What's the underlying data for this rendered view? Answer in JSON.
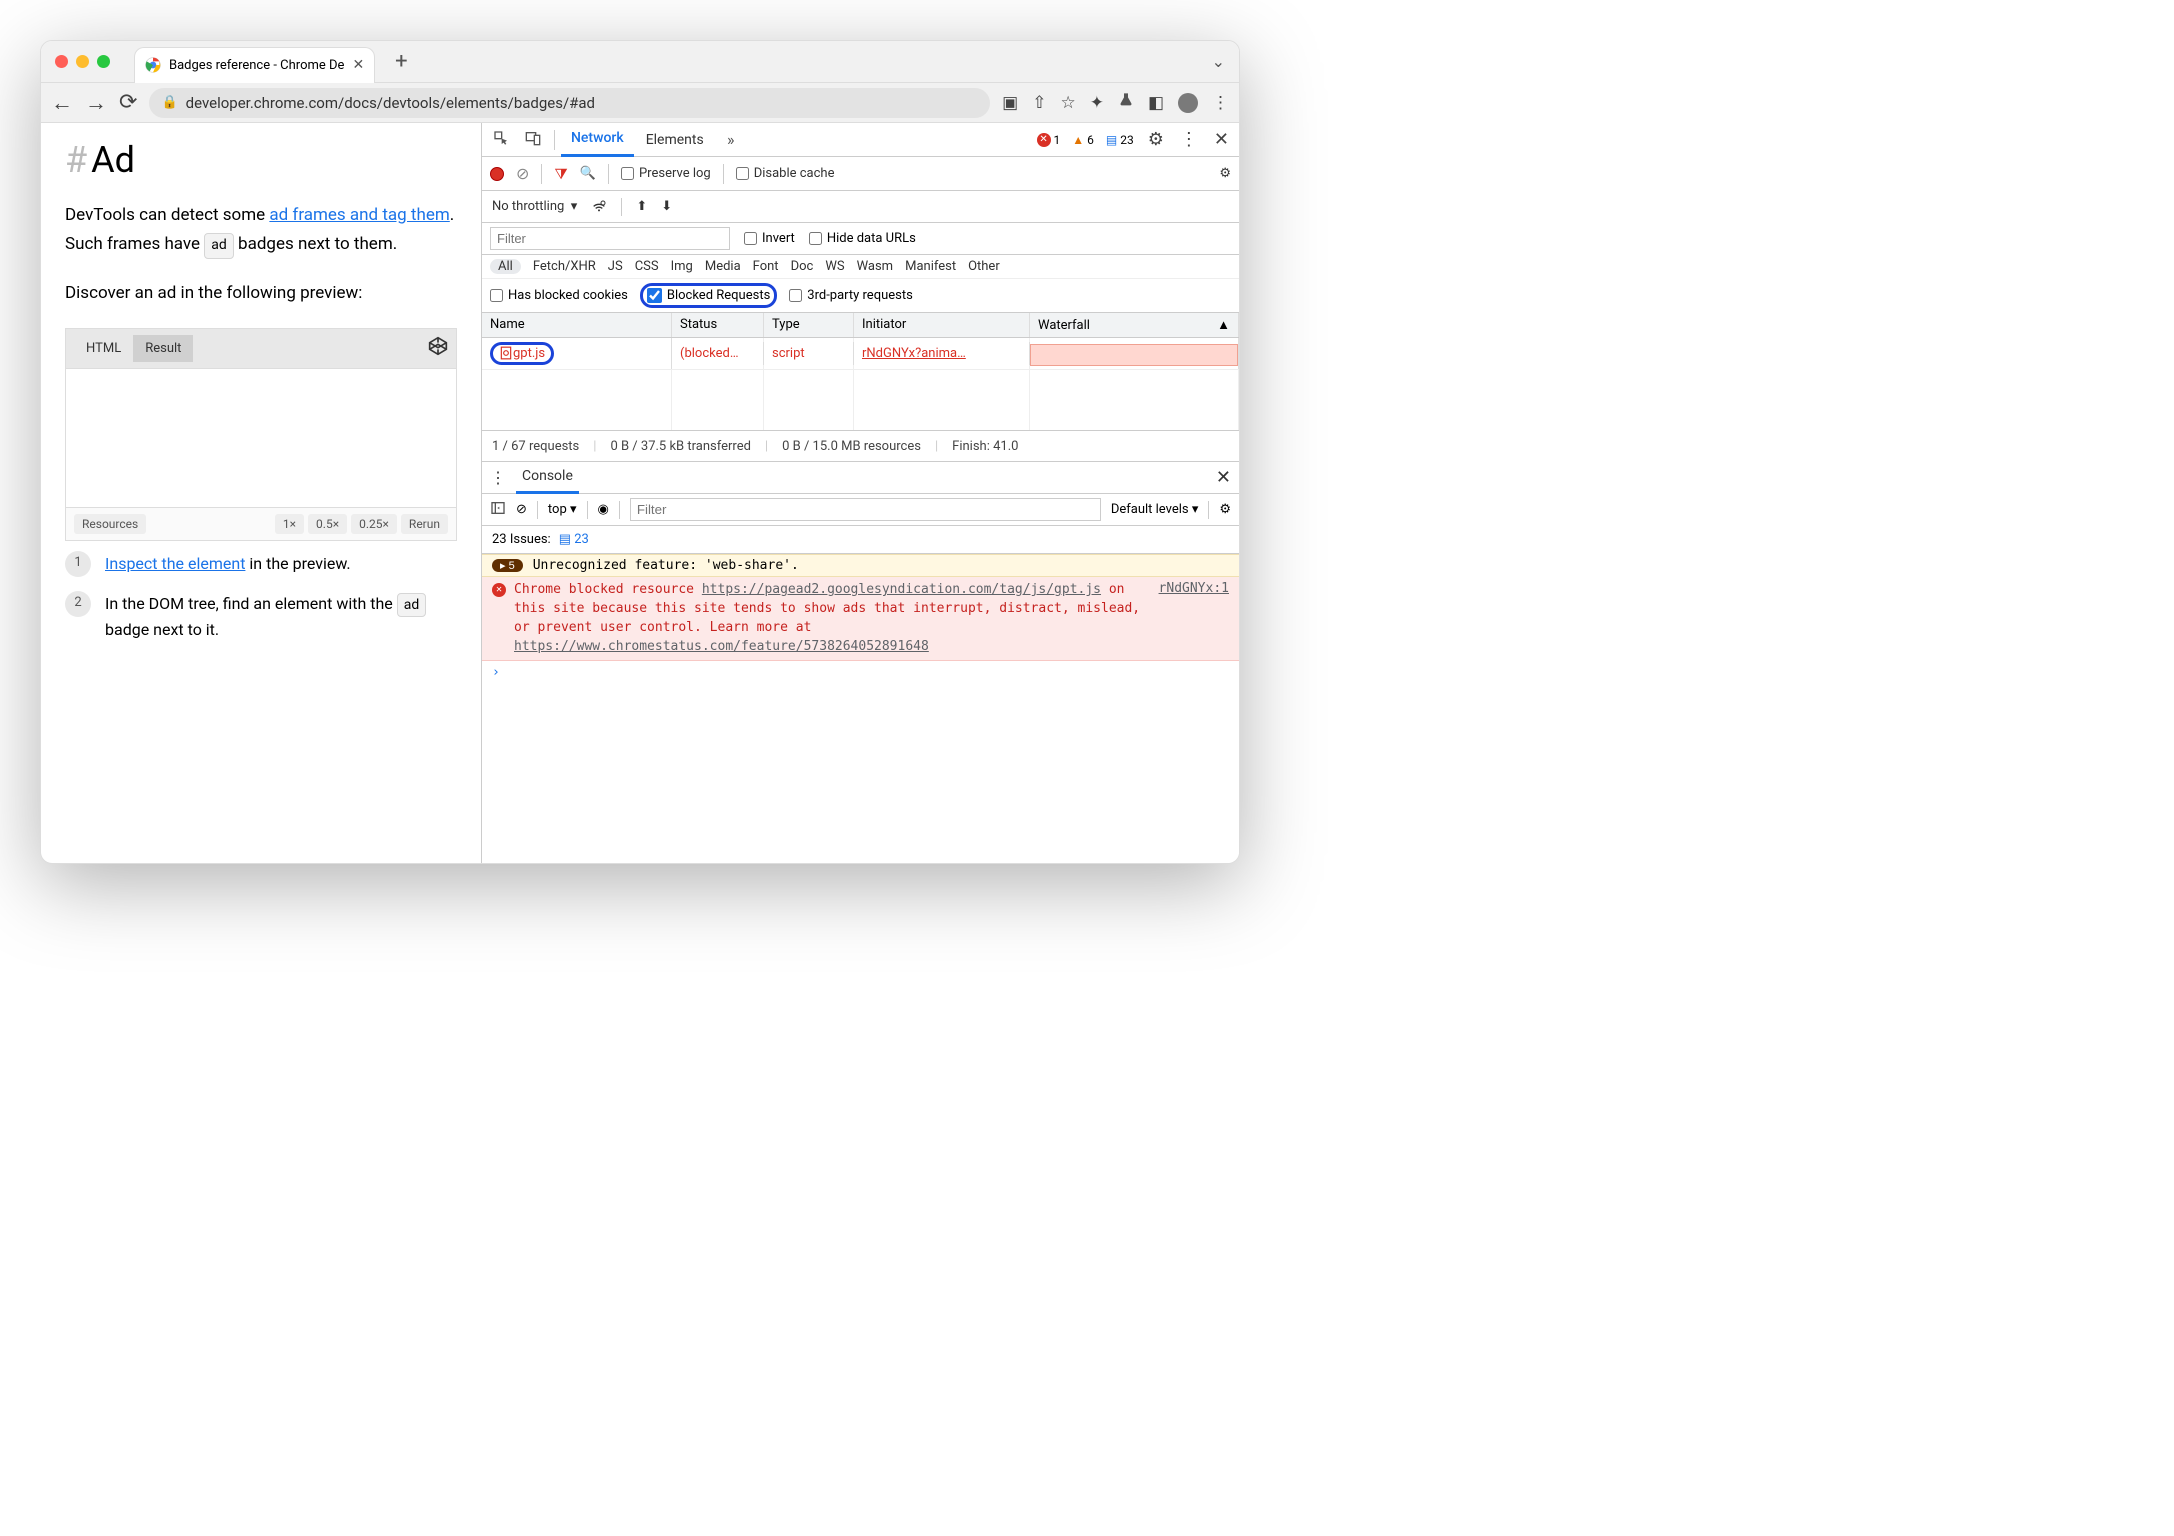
{
  "tab_title": "Badges reference - Chrome De",
  "url": "developer.chrome.com/docs/devtools/elements/badges/#ad",
  "page": {
    "heading": "Ad",
    "p1_a": "DevTools can detect some ",
    "p1_link": "ad frames and tag them",
    "p1_b": ". Such frames have ",
    "p1_badge": "ad",
    "p1_c": " badges next to them.",
    "p2": "Discover an ad in the following preview:",
    "codepen": {
      "tab_html": "HTML",
      "tab_result": "Result",
      "foot_resources": "Resources",
      "foot_1x": "1×",
      "foot_05x": "0.5×",
      "foot_025x": "0.25×",
      "foot_rerun": "Rerun"
    },
    "step1_link": "Inspect the element",
    "step1_rest": " in the preview.",
    "step2_a": "In the DOM tree, find an element with the ",
    "step2_badge": "ad",
    "step2_b": " badge next to it."
  },
  "devtools": {
    "tabs": {
      "network": "Network",
      "elements": "Elements"
    },
    "status": {
      "errors": "1",
      "warnings": "6",
      "messages": "23"
    },
    "toolbar": {
      "preserve_log": "Preserve log",
      "disable_cache": "Disable cache"
    },
    "throttle": "No throttling",
    "filter_placeholder": "Filter",
    "invert": "Invert",
    "hide_urls": "Hide data URLs",
    "chips": [
      "All",
      "Fetch/XHR",
      "JS",
      "CSS",
      "Img",
      "Media",
      "Font",
      "Doc",
      "WS",
      "Wasm",
      "Manifest",
      "Other"
    ],
    "has_blocked_cookies": "Has blocked cookies",
    "blocked_requests": "Blocked Requests",
    "third_party": "3rd-party requests",
    "cols": {
      "name": "Name",
      "status": "Status",
      "type": "Type",
      "initiator": "Initiator",
      "waterfall": "Waterfall"
    },
    "row": {
      "name": "gpt.js",
      "status": "(blocked…",
      "type": "script",
      "initiator": "rNdGNYx?anima…"
    },
    "summary": {
      "requests": "1 / 67 requests",
      "transferred": "0 B / 37.5 kB transferred",
      "resources": "0 B / 15.0 MB resources",
      "finish": "Finish: 41.0"
    }
  },
  "console": {
    "tab": "Console",
    "context": "top",
    "filter_placeholder": "Filter",
    "levels": "Default levels",
    "issues": "23 Issues:",
    "issues_count": "23",
    "warn_count": "5",
    "warn_text": "Unrecognized feature: 'web-share'.",
    "err_source": "rNdGNYx:1",
    "err_prefix": "Chrome blocked resource ",
    "err_url1": "https://pagead2.googlesyndication.com/tag/js/gpt.js",
    "err_mid": " on this site because this site tends to show ads that interrupt, distract, mislead, or prevent user control. Learn more at ",
    "err_url2": "https://www.chromestatus.com/feature/5738264052891648"
  }
}
